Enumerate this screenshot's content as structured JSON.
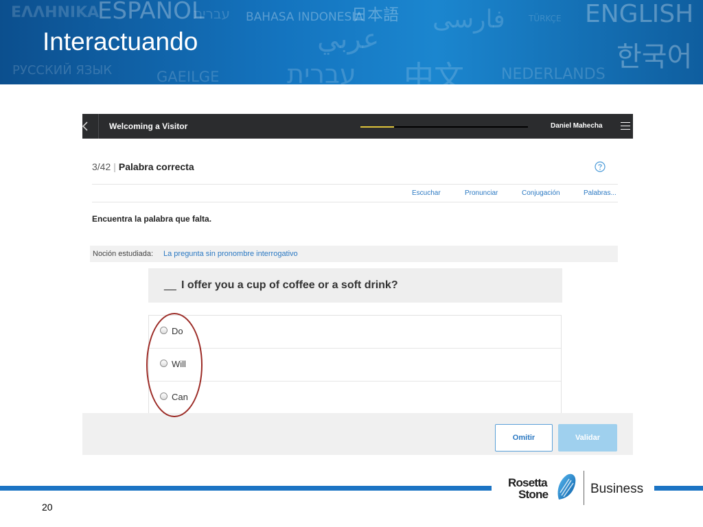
{
  "slide": {
    "title": "Interactuando",
    "page_number": "20",
    "background_languages": [
      "ΕΛΛΗΝΙΚΑ",
      "ESPAÑOL",
      "עברית",
      "BAHASA INDONESIA",
      "日本語",
      "فارسی",
      "TÜRKÇE",
      "ENGLISH",
      "عربي",
      "한국어",
      "РУССКИЙ ЯЗЫК",
      "GAEILGE",
      "עברית",
      "中文",
      "NEDERLANDS"
    ],
    "logo": {
      "line1": "Rosetta",
      "line2": "Stone",
      "suffix": "Business"
    }
  },
  "topbar": {
    "lesson_title": "Welcoming a Visitor",
    "progress": 0.2,
    "user_name": "Daniel Mahecha",
    "back_icon": "chevron-left-icon",
    "menu_icon": "hamburger-menu-icon"
  },
  "activity": {
    "counter": "3/42",
    "separator": "|",
    "name": "Palabra correcta",
    "help_icon": "question-circle-icon"
  },
  "tools": [
    "Escuchar",
    "Pronunciar",
    "Conjugación",
    "Palabras..."
  ],
  "instruction": "Encuentra la palabra que falta.",
  "notion": {
    "label": "Noción estudiada:",
    "value": "La pregunta sin pronombre interrogativo"
  },
  "question": {
    "blank": "__",
    "text": "I offer you a cup of coffee or a soft drink?"
  },
  "options": [
    "Do",
    "Will",
    "Can"
  ],
  "buttons": {
    "skip": "Omitir",
    "validate": "Validar"
  },
  "colors": {
    "banner_blue": "#1474bf",
    "topbar": "#2b2c2e",
    "progress_fill": "#e0c53a",
    "link_blue": "#2a78c2",
    "validate_disabled": "#9fd0ee",
    "annotation_red": "#9b2a25"
  }
}
